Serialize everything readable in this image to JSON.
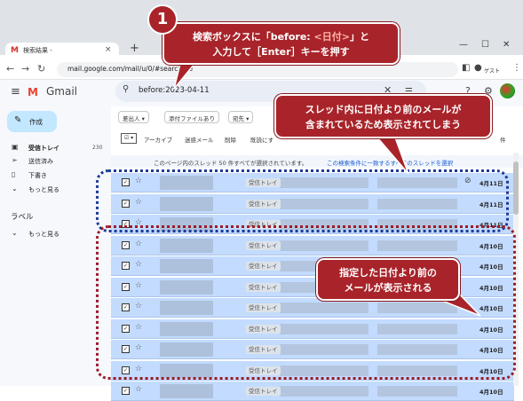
{
  "browser": {
    "tab_title": "検索結果 - ",
    "url": "mail.google.com/mail/u/0/#search/be",
    "guest_label": "ゲスト"
  },
  "gmail": {
    "app_name": "Gmail",
    "search_query": "before:2023-04-11",
    "compose_label": "作成"
  },
  "sidebar": {
    "items": [
      {
        "icon": "inbox-icon",
        "label": "受信トレイ",
        "count": "230"
      },
      {
        "icon": "send-icon",
        "label": "送信済み",
        "count": ""
      },
      {
        "icon": "draft-icon",
        "label": "下書き",
        "count": ""
      },
      {
        "icon": "chevron-down-icon",
        "label": "もっと見る",
        "count": ""
      }
    ],
    "labels_heading": "ラベル",
    "labels_more": "もっと見る"
  },
  "filters": [
    "差出人 ▾",
    "添付ファイルあり",
    "宛先 ▾"
  ],
  "toolbar": {
    "select_all": "☑ ▾",
    "actions": [
      "アーカイブ",
      "迷惑メール",
      "削除",
      "既読にす"
    ],
    "right_text": "件"
  },
  "notice": {
    "text": "このページ内のスレッド 50 件すべてが選択されています。",
    "link": "この検索条件に一致するすべてのスレッドを選択"
  },
  "rows": [
    {
      "tag": "受信トレイ",
      "date": "4月11日",
      "attachment": true
    },
    {
      "tag": "受信トレイ",
      "date": "4月11日",
      "attachment": false
    },
    {
      "tag": "受信トレイ",
      "date": "4月11日",
      "attachment": false
    },
    {
      "tag": "受信トレイ",
      "date": "4月10日",
      "attachment": false
    },
    {
      "tag": "受信トレイ",
      "date": "4月10日",
      "attachment": false
    },
    {
      "tag": "受信トレイ",
      "date": "4月10日",
      "attachment": false
    },
    {
      "tag": "受信トレイ",
      "date": "4月10日",
      "attachment": false
    },
    {
      "tag": "受信トレイ",
      "date": "4月10日",
      "attachment": false
    },
    {
      "tag": "受信トレイ",
      "date": "4月10日",
      "attachment": false
    },
    {
      "tag": "受信トレイ",
      "date": "4月10日",
      "attachment": false
    },
    {
      "tag": "受信トレイ",
      "date": "4月10日",
      "attachment": false
    }
  ],
  "callouts": {
    "step_number": "1",
    "c1_line1_a": "検索ボックスに「before: ",
    "c1_line1_accent": "<日付>",
    "c1_line1_b": "」と",
    "c1_line2": "入力して［Enter］キーを押す",
    "c2_line1": "スレッド内に日付より前のメールが",
    "c2_line2": "含まれているため表示されてしまう",
    "c3_line1": "指定した日付より前の",
    "c3_line2": "メールが表示される"
  },
  "colors": {
    "callout_bg": "#a8242a",
    "selected_row": "#c2dbff",
    "blue_dotted": "#1e3a96",
    "red_dotted": "#9b1c2a"
  }
}
